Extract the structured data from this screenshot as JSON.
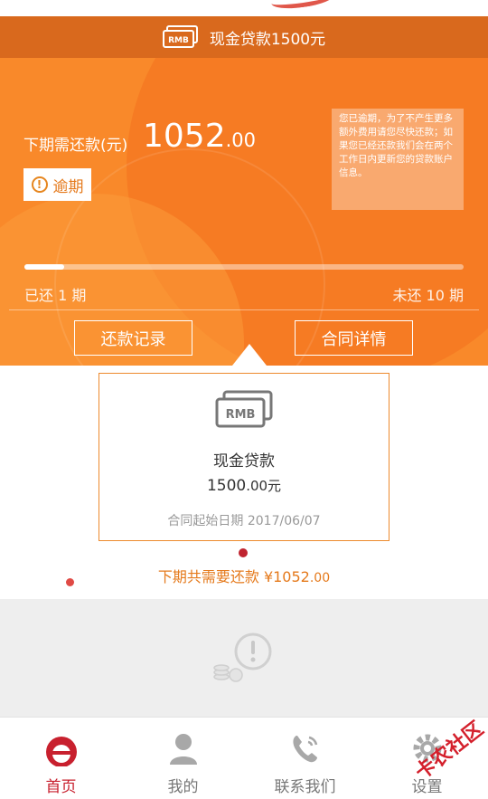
{
  "header": {
    "title": "现金贷款1500元",
    "icon": "rmb-banknote-icon",
    "icon_text": "RMB"
  },
  "due": {
    "label": "下期需还款(元)",
    "amount_int": "1052",
    "amount_dec": ".00",
    "status_badge": "逾期",
    "status_icon": "warning-icon"
  },
  "notice": {
    "text": "您已逾期，为了不产生更多额外费用请您尽快还款；如果您已经还款我们会在两个工作日内更新您的贷款账户信息。"
  },
  "progress": {
    "paid_label": "已还 1 期",
    "unpaid_label": "未还 10 期",
    "paid": 1,
    "unpaid": 10,
    "fraction": 0.091
  },
  "actions": {
    "records_label": "还款记录",
    "contract_label": "合同详情"
  },
  "card": {
    "icon": "rmb-banknote-icon",
    "icon_text": "RMB",
    "name": "现金贷款",
    "amount_int": "1500",
    "amount_dec": ".00元",
    "start_date": "合同起始日期 2017/06/07"
  },
  "total": {
    "prefix": "下期共需要还款 ¥1052",
    "dec": ".00"
  },
  "nav": {
    "items": [
      {
        "label": "首页",
        "icon": "home-icon",
        "active": true
      },
      {
        "label": "我的",
        "icon": "user-icon",
        "active": false
      },
      {
        "label": "联系我们",
        "icon": "phone-icon",
        "active": false
      },
      {
        "label": "设置",
        "icon": "gear-icon",
        "active": false
      }
    ]
  },
  "watermark": {
    "text": "卡农社区"
  },
  "colors": {
    "accent": "#f9892a",
    "titlebar": "#d9691d",
    "brand_red": "#c8202e"
  }
}
